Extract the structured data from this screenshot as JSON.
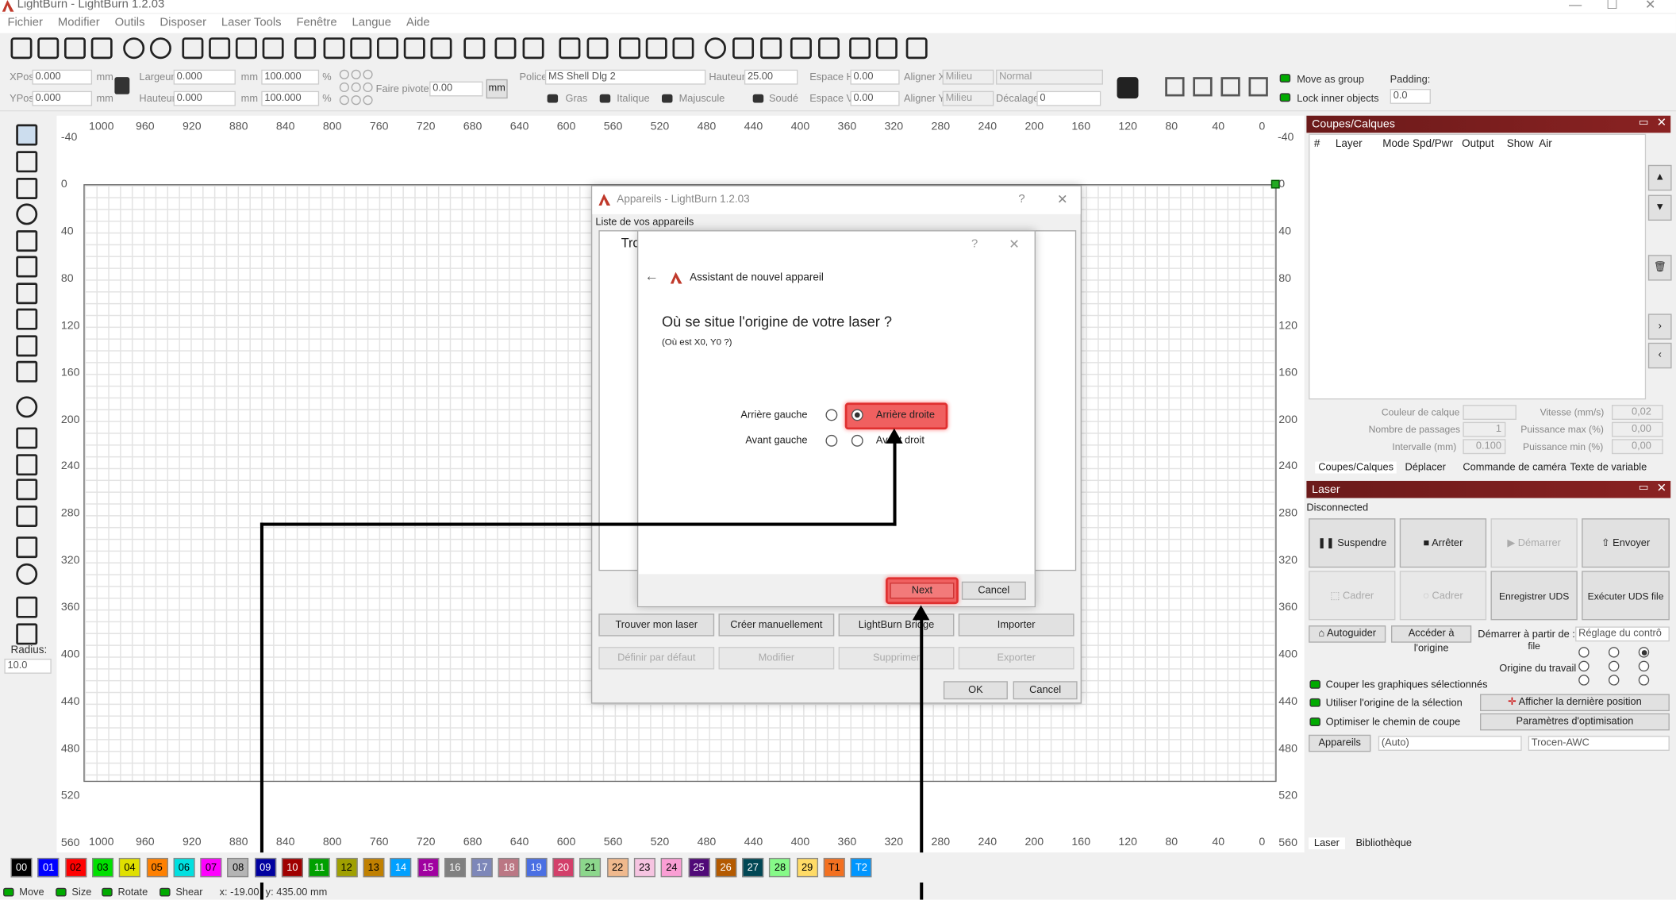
{
  "window": {
    "title": "LightBurn - LightBurn 1.2.03"
  },
  "menu": [
    "Fichier",
    "Modifier",
    "Outils",
    "Disposer",
    "Laser Tools",
    "Fenêtre",
    "Langue",
    "Aide"
  ],
  "props": {
    "xpos_label": "XPos",
    "xpos": "0.000",
    "ypos_label": "YPos",
    "ypos": "0.000",
    "unit": "mm",
    "width_label": "Largeur",
    "width": "0.000",
    "height_label": "Hauteur",
    "height": "0.000",
    "pct": "100.000",
    "pct_sign": "%",
    "pivot_label": "Faire pivoter",
    "pivot": "0.00",
    "mm_btn": "mm",
    "font_label": "Police",
    "font": "MS Shell Dlg 2",
    "fheight_label": "Hauteur",
    "fheight": "25.00",
    "spaceh_label": "Espace H",
    "spaceh": "0.00",
    "spacev_label": "Espace V",
    "spacev": "0.00",
    "alignx_label": "Aligner X",
    "alignx": "Milieu",
    "aligny_label": "Aligner Y",
    "aligny": "Milieu",
    "normal": "Normal",
    "offset_label": "Décalage",
    "offset": "0",
    "bold": "Gras",
    "italic": "Italique",
    "upper": "Majuscule",
    "welded": "Soudé",
    "move_group": "Move as group",
    "lock_inner": "Lock inner objects",
    "padding_label": "Padding:",
    "padding": "0.0"
  },
  "left": {
    "radius_label": "Radius:",
    "radius": "10.0"
  },
  "ruler": {
    "top": [
      "1000",
      "960",
      "920",
      "880",
      "840",
      "800",
      "760",
      "720",
      "680",
      "640",
      "600",
      "560",
      "520",
      "480",
      "440",
      "400",
      "360",
      "320",
      "280",
      "240",
      "200",
      "160",
      "120",
      "80",
      "40",
      "0"
    ],
    "top_extra": "-40",
    "left": [
      "0",
      "40",
      "80",
      "120",
      "160",
      "200",
      "240",
      "280",
      "320",
      "360",
      "400",
      "440",
      "480",
      "520",
      "560"
    ],
    "left_top": "-40"
  },
  "devices_dlg": {
    "title": "Appareils - LightBurn 1.2.03",
    "help": "?",
    "close": "✕",
    "list_label": "Liste de vos appareils",
    "item": "Tro",
    "buttons": [
      "Trouver mon laser",
      "Créer manuellement",
      "LightBurn Bridge",
      "Importer"
    ],
    "buttons2": [
      "Définir par défaut",
      "Modifier",
      "Supprimer",
      "Exporter"
    ],
    "ok": "OK",
    "cancel": "Cancel"
  },
  "wizard": {
    "help": "?",
    "close": "✕",
    "back": "←",
    "title": "Assistant de nouvel appareil",
    "question": "Où se situe l'origine de votre laser ?",
    "sub": "(Où est X0, Y0 ?)",
    "rear_left": "Arrière gauche",
    "rear_right": "Arrière droite",
    "front_left": "Avant gauche",
    "front_right": "Avant droit",
    "next": "Next",
    "cancel": "Cancel"
  },
  "cuts": {
    "title": "Coupes/Calques",
    "cols": [
      "#",
      "Layer",
      "Mode",
      "Spd/Pwr",
      "Output",
      "Show",
      "Air"
    ],
    "color_label": "Couleur de calque",
    "speed_label": "Vitesse (mm/s)",
    "speed": "0,02",
    "passes_label": "Nombre de passages",
    "passes": "1",
    "maxp_label": "Puissance max (%)",
    "maxp": "0,00",
    "interval_label": "Intervalle (mm)",
    "interval": "0.100",
    "minp_label": "Puissance min (%)",
    "minp": "0,00",
    "tabs": [
      "Coupes/Calques",
      "Déplacer",
      "Commande de caméra",
      "Texte de variable"
    ]
  },
  "laser": {
    "title": "Laser",
    "status": "Disconnected",
    "pause": "Suspendre",
    "stop": "Arrêter",
    "start": "Démarrer",
    "send": "Envoyer",
    "frame1": "Cadrer",
    "frame2": "Cadrer",
    "save_uds": "Enregistrer UDS file",
    "run_uds": "Exécuter UDS file",
    "home": "Autoguider",
    "goto_origin": "Accéder à l'origine",
    "start_from_label": "Démarrer à partir de :",
    "start_from": "Réglage du contrô",
    "job_origin": "Origine du travail",
    "cut_selected": "Couper les graphiques sélectionnés",
    "use_sel_origin": "Utiliser l'origine de la sélection",
    "optimize": "Optimiser le chemin de coupe",
    "show_last": "Afficher la dernière position",
    "opt_settings": "Paramètres d'optimisation",
    "devices": "Appareils",
    "port": "(Auto)",
    "device": "Trocen-AWC"
  },
  "bottom_tabs": [
    "Laser",
    "Bibliothèque"
  ],
  "colors": [
    {
      "l": "00",
      "c": "#000000",
      "t": "#fff"
    },
    {
      "l": "01",
      "c": "#0000ff",
      "t": "#fff"
    },
    {
      "l": "02",
      "c": "#ff0000",
      "t": "#000"
    },
    {
      "l": "03",
      "c": "#00e000",
      "t": "#000"
    },
    {
      "l": "04",
      "c": "#e0e000",
      "t": "#000"
    },
    {
      "l": "05",
      "c": "#ff8000",
      "t": "#000"
    },
    {
      "l": "06",
      "c": "#00e0e0",
      "t": "#000"
    },
    {
      "l": "07",
      "c": "#ff00ff",
      "t": "#000"
    },
    {
      "l": "08",
      "c": "#b4b4b4",
      "t": "#000"
    },
    {
      "l": "09",
      "c": "#0000a0",
      "t": "#fff"
    },
    {
      "l": "10",
      "c": "#a00000",
      "t": "#fff"
    },
    {
      "l": "11",
      "c": "#00a000",
      "t": "#fff"
    },
    {
      "l": "12",
      "c": "#a0a000",
      "t": "#000"
    },
    {
      "l": "13",
      "c": "#c08000",
      "t": "#000"
    },
    {
      "l": "14",
      "c": "#00a0ff",
      "t": "#fff"
    },
    {
      "l": "15",
      "c": "#a000a0",
      "t": "#fff"
    },
    {
      "l": "16",
      "c": "#808080",
      "t": "#fff"
    },
    {
      "l": "17",
      "c": "#7d87b9",
      "t": "#fff"
    },
    {
      "l": "18",
      "c": "#bb7784",
      "t": "#fff"
    },
    {
      "l": "19",
      "c": "#4a6fe3",
      "t": "#fff"
    },
    {
      "l": "20",
      "c": "#d33f6a",
      "t": "#fff"
    },
    {
      "l": "21",
      "c": "#8cd78c",
      "t": "#000"
    },
    {
      "l": "22",
      "c": "#f0b98d",
      "t": "#000"
    },
    {
      "l": "23",
      "c": "#f6c4e1",
      "t": "#000"
    },
    {
      "l": "24",
      "c": "#fa9ed4",
      "t": "#000"
    },
    {
      "l": "25",
      "c": "#500a78",
      "t": "#fff"
    },
    {
      "l": "26",
      "c": "#b45a00",
      "t": "#fff"
    },
    {
      "l": "27",
      "c": "#004754",
      "t": "#fff"
    },
    {
      "l": "28",
      "c": "#86fa88",
      "t": "#000"
    },
    {
      "l": "29",
      "c": "#ffdb66",
      "t": "#000"
    },
    {
      "l": "T1",
      "c": "#f37020",
      "t": "#000"
    },
    {
      "l": "T2",
      "c": "#0096ff",
      "t": "#fff"
    }
  ],
  "status": {
    "move": "Move",
    "size": "Size",
    "rotate": "Rotate",
    "shear": "Shear",
    "x": "x: -19.00",
    "y": "y: 435.00 mm"
  },
  "accent": {
    "highlight": "#f06060",
    "panel": "#6b1a1a"
  }
}
